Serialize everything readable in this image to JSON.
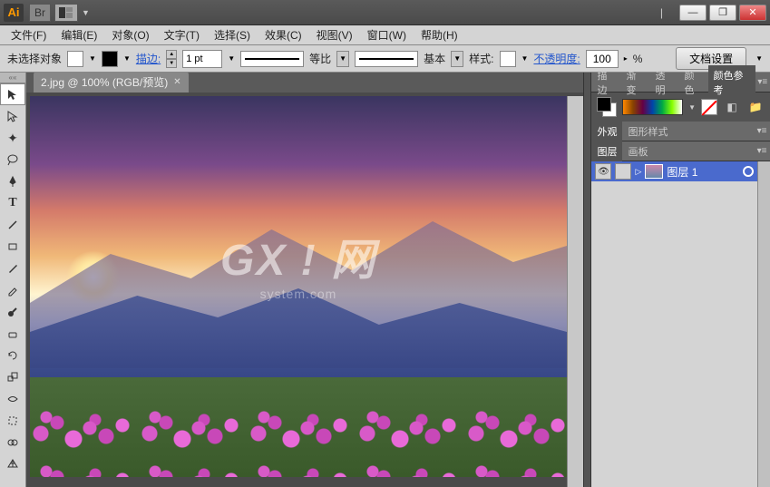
{
  "title_bar": {
    "app_abbrev": "Ai",
    "badge": "Br"
  },
  "window_controls": {
    "minimize": "—",
    "maximize": "❐",
    "close": "✕"
  },
  "menu": {
    "file": "文件(F)",
    "edit": "编辑(E)",
    "object": "对象(O)",
    "type": "文字(T)",
    "select": "选择(S)",
    "effect": "效果(C)",
    "view": "视图(V)",
    "window": "窗口(W)",
    "help": "帮助(H)"
  },
  "control": {
    "no_selection": "未选择对象",
    "stroke_label": "描边:",
    "stroke_weight": "1 pt",
    "uniform": "等比",
    "basic": "基本",
    "style": "样式:",
    "opacity_label": "不透明度:",
    "opacity_value": "100",
    "opacity_unit": "%",
    "doc_setup": "文档设置"
  },
  "document": {
    "tab_title": "2.jpg @ 100% (RGB/预览)",
    "watermark": "GX ! 网",
    "watermark_sub": "system.com"
  },
  "panels": {
    "group1": {
      "stroke": "描边",
      "grad": "渐变",
      "transp": "透明",
      "color": "颜色",
      "color_guide": "颜色参考"
    },
    "group2": {
      "appearance": "外观",
      "graphic_styles": "图形样式"
    },
    "group3": {
      "layers": "图层",
      "artboards": "画板"
    }
  },
  "layers": {
    "item1": "图层 1"
  }
}
